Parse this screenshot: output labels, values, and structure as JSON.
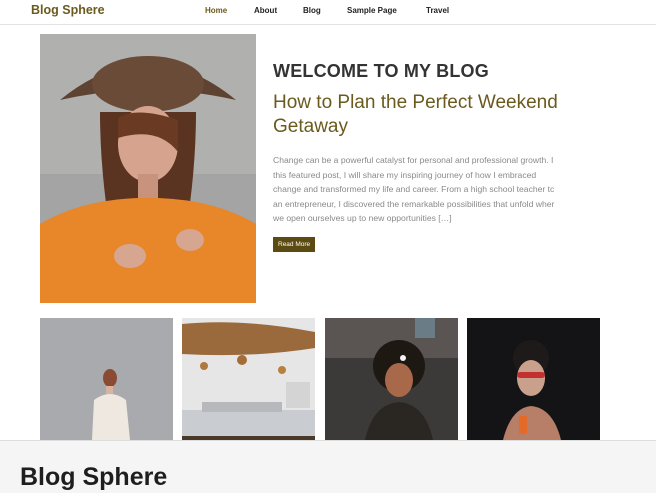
{
  "site": {
    "title": "Blog Sphere",
    "accent_color": "#6b5a1e"
  },
  "nav": {
    "items": [
      "Home",
      "About",
      "Blog",
      "Sample Page",
      "Travel"
    ],
    "active": "Home"
  },
  "hero": {
    "heading": "WELCOME TO MY BLOG",
    "post_title": "How to Plan the Perfect Weekend Getaway",
    "excerpt_lines": [
      "Change can be a powerful catalyst for personal and professional growth. I",
      "this featured post, I will share my inspiring journey of how I embraced",
      "change and transformed my life and career. From a high school teacher tc",
      "an entrepreneur, I discovered the remarkable possibilities that unfold wher",
      "we open ourselves up to new opportunities […]"
    ],
    "read_more": "Read More"
  },
  "footer": {
    "title": "Blog Sphere"
  }
}
